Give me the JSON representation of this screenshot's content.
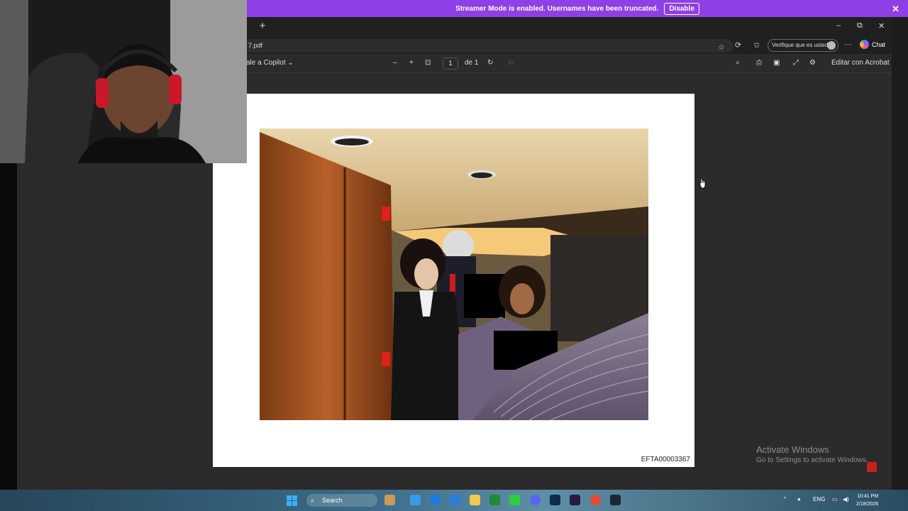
{
  "banner": {
    "message": "Streamer Mode is enabled. Usernames have been truncated.",
    "disable_label": "Disable",
    "close_glyph": "✕"
  },
  "browser": {
    "new_tab_glyph": "+",
    "window_controls": {
      "minimize": "–",
      "restore": "⧉",
      "close": "✕"
    },
    "url": "7.pdf",
    "verify_label": "Verifique que es usted",
    "more_glyph": "···",
    "chat_label": "Chat"
  },
  "pdf_toolbar": {
    "copilot_label": "ale a Copilot",
    "zoom_out": "–",
    "zoom_in": "+",
    "page_current": "1",
    "page_total": "de 1",
    "edit_acrobat": "Editar con Acrobat"
  },
  "document": {
    "page_id": "EFTA00003367"
  },
  "watermark": {
    "title": "Activate Windows",
    "subtitle": "Go to Settings to activate Windows."
  },
  "taskbar": {
    "search_label": "Search",
    "lang": "ENG",
    "time": "10:41 PM",
    "date": "2/18/2026"
  },
  "icons": {
    "star": "star-icon",
    "refresh": "refresh-icon",
    "favorites": "favorites-icon",
    "search": "search-icon",
    "print": "print-icon",
    "save": "save-icon",
    "settings": "gear-icon"
  },
  "colors": {
    "banner_bg": "#8f3fe6",
    "browser_bg": "#2b2b2b",
    "page_bg": "#ffffff"
  }
}
